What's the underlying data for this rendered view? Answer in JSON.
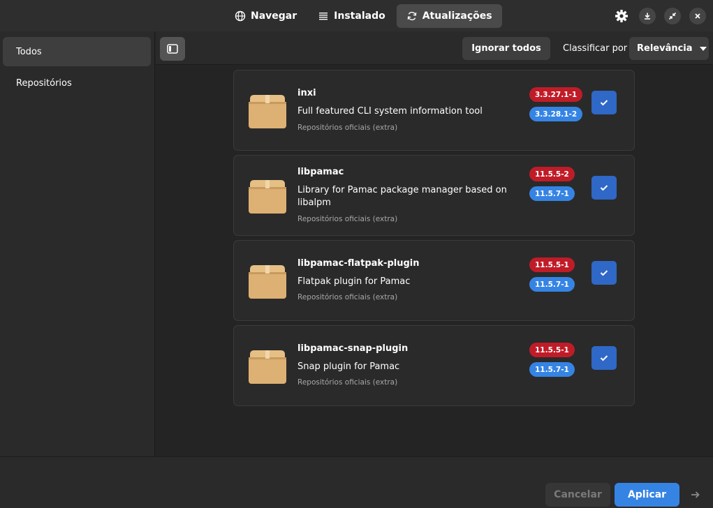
{
  "header": {
    "tabs": [
      {
        "label": "Navegar",
        "icon": "globe-icon"
      },
      {
        "label": "Instalado",
        "icon": "list-icon"
      },
      {
        "label": "Atualizações",
        "icon": "refresh-icon"
      }
    ],
    "active_tab": "Atualizações"
  },
  "sidebar": {
    "items": [
      {
        "label": "Todos",
        "selected": true
      },
      {
        "label": "Repositórios",
        "selected": false
      }
    ]
  },
  "toolbar": {
    "ignore_all_label": "Ignorar todos",
    "sort_label": "Classificar por",
    "sort_value": "Relevância"
  },
  "packages": [
    {
      "name": "inxi",
      "description": "Full featured CLI system information tool",
      "repo": "Repositórios oficiais (extra)",
      "old_version": "3.3.27.1-1",
      "new_version": "3.3.28.1-2",
      "checked": true
    },
    {
      "name": "libpamac",
      "description": "Library for Pamac package manager based on libalpm",
      "repo": "Repositórios oficiais (extra)",
      "old_version": "11.5.5-2",
      "new_version": "11.5.7-1",
      "checked": true
    },
    {
      "name": "libpamac-flatpak-plugin",
      "description": "Flatpak plugin for Pamac",
      "repo": "Repositórios oficiais (extra)",
      "old_version": "11.5.5-1",
      "new_version": "11.5.7-1",
      "checked": true
    },
    {
      "name": "libpamac-snap-plugin",
      "description": "Snap plugin for Pamac",
      "repo": "Repositórios oficiais (extra)",
      "old_version": "11.5.5-1",
      "new_version": "11.5.7-1",
      "checked": true
    }
  ],
  "footer": {
    "cancel_label": "Cancelar",
    "apply_label": "Aplicar"
  },
  "colors": {
    "accent": "#3584e4",
    "old_version": "#c01c28",
    "new_version": "#3584e4",
    "checkbox": "#2f68c6"
  }
}
